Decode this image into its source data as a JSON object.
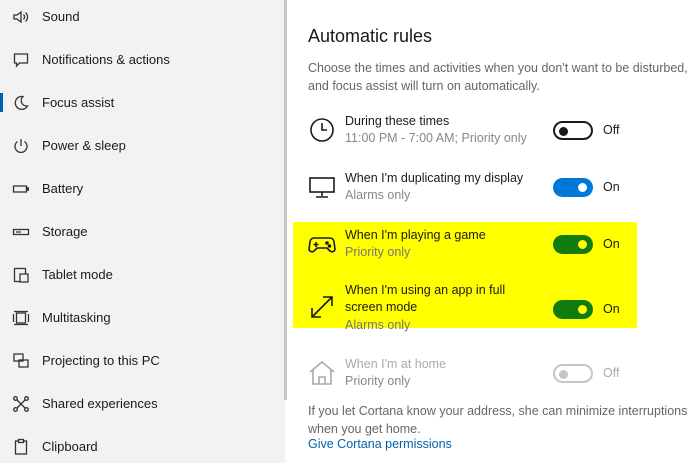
{
  "sidebar": {
    "items": [
      {
        "label": "Sound",
        "icon": "speaker-icon"
      },
      {
        "label": "Notifications & actions",
        "icon": "message-icon"
      },
      {
        "label": "Focus assist",
        "icon": "moon-icon",
        "active": true
      },
      {
        "label": "Power & sleep",
        "icon": "power-icon"
      },
      {
        "label": "Battery",
        "icon": "battery-icon"
      },
      {
        "label": "Storage",
        "icon": "storage-icon"
      },
      {
        "label": "Tablet mode",
        "icon": "tablet-icon"
      },
      {
        "label": "Multitasking",
        "icon": "multitasking-icon"
      },
      {
        "label": "Projecting to this PC",
        "icon": "projecting-icon"
      },
      {
        "label": "Shared experiences",
        "icon": "shared-icon"
      },
      {
        "label": "Clipboard",
        "icon": "clipboard-icon"
      }
    ]
  },
  "main": {
    "title": "Automatic rules",
    "description": "Choose the times and activities when you don't want to be disturbed, and focus assist will turn on automatically.",
    "rules": [
      {
        "title": "During these times",
        "subtitle": "11:00 PM - 7:00 AM; Priority only",
        "state": "Off",
        "icon": "clock-icon"
      },
      {
        "title": "When I'm duplicating my display",
        "subtitle": "Alarms only",
        "state": "On",
        "icon": "monitor-icon"
      },
      {
        "title": "When I'm playing a game",
        "subtitle": "Priority only",
        "state": "On",
        "icon": "gamepad-icon"
      },
      {
        "title": "When I'm using an app in full screen mode",
        "subtitle": "Alarms only",
        "state": "On",
        "icon": "fullscreen-icon"
      },
      {
        "title": "When I'm at home",
        "subtitle": "Priority only",
        "state": "Off",
        "icon": "home-icon"
      }
    ],
    "footer": "If you let Cortana know your address, she can minimize interruptions when you get home.",
    "link": "Give Cortana permissions"
  },
  "colors": {
    "accent": "#0078d7",
    "highlight": "#ffff00",
    "toggle_on_highlighted": "#107c10",
    "link": "#0063b1"
  }
}
